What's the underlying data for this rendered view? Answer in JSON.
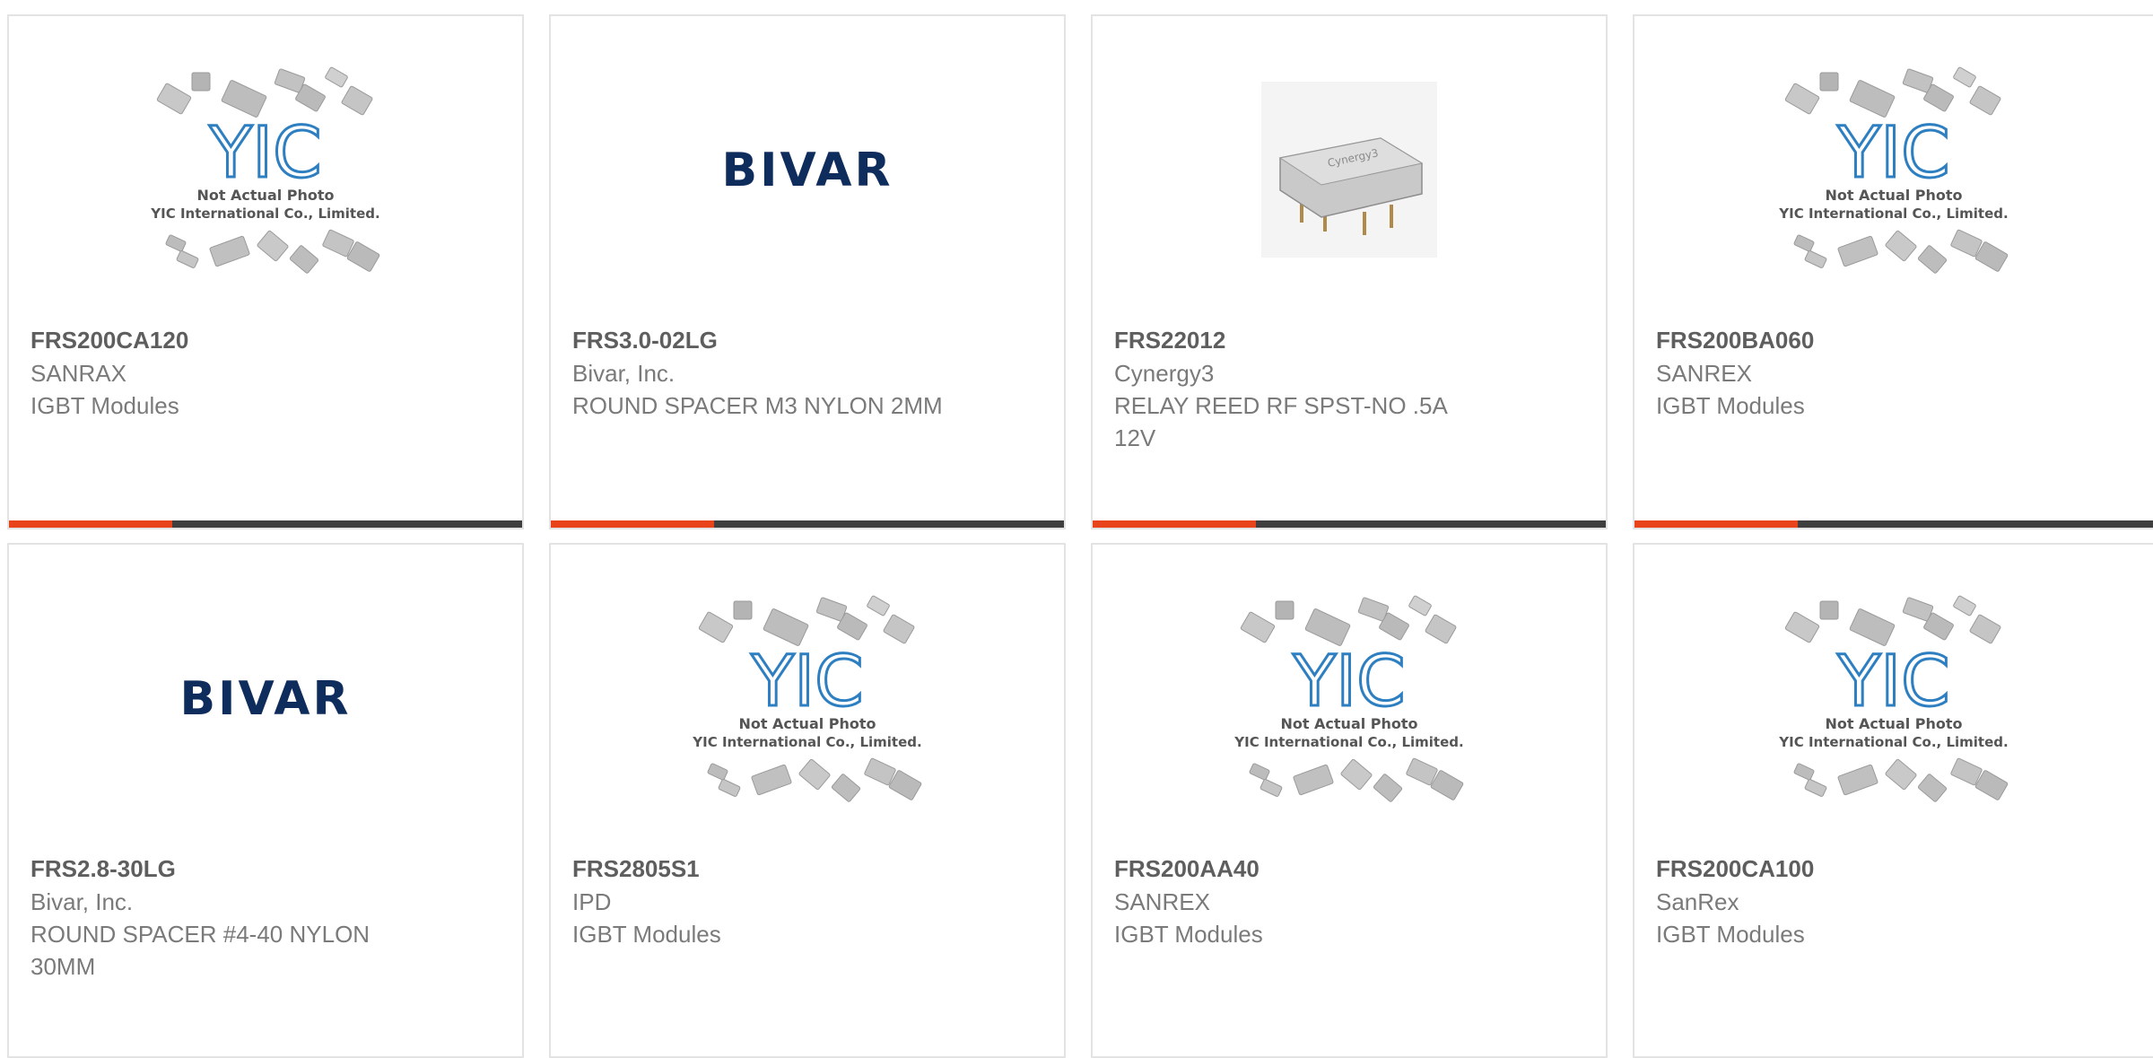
{
  "products": [
    {
      "part_number": "FRS200CA120",
      "manufacturer": "SANRAX",
      "description": "IGBT Modules",
      "image": "yic-placeholder"
    },
    {
      "part_number": "FRS3.0-02LG",
      "manufacturer": "Bivar, Inc.",
      "description": "ROUND SPACER M3 NYLON 2MM",
      "image": "bivar-logo"
    },
    {
      "part_number": "FRS22012",
      "manufacturer": "Cynergy3",
      "description": "RELAY REED RF SPST-NO .5A 12V",
      "image": "relay-photo"
    },
    {
      "part_number": "FRS200BA060",
      "manufacturer": "SANREX",
      "description": "IGBT Modules",
      "image": "yic-placeholder"
    },
    {
      "part_number": "FRS2.8-30LG",
      "manufacturer": "Bivar, Inc.",
      "description": "ROUND SPACER #4-40 NYLON 30MM",
      "image": "bivar-logo"
    },
    {
      "part_number": "FRS2805S1",
      "manufacturer": "IPD",
      "description": "IGBT Modules",
      "image": "yic-placeholder"
    },
    {
      "part_number": "FRS200AA40",
      "manufacturer": "SANREX",
      "description": "IGBT Modules",
      "image": "yic-placeholder"
    },
    {
      "part_number": "FRS200CA100",
      "manufacturer": "SanRex",
      "description": "IGBT Modules",
      "image": "yic-placeholder"
    }
  ],
  "placeholder": {
    "logo_text": "YIC",
    "line1": "Not Actual Photo",
    "line2": "YIC International Co., Limited."
  },
  "bivar_logo_text": "BIVAR",
  "relay_label": "Cynergy3",
  "colors": {
    "accent": "#e8431a",
    "bar_dark": "#3f3f3f",
    "bivar_navy": "#0f2d5c",
    "yic_blue": "#2d7fc1"
  }
}
